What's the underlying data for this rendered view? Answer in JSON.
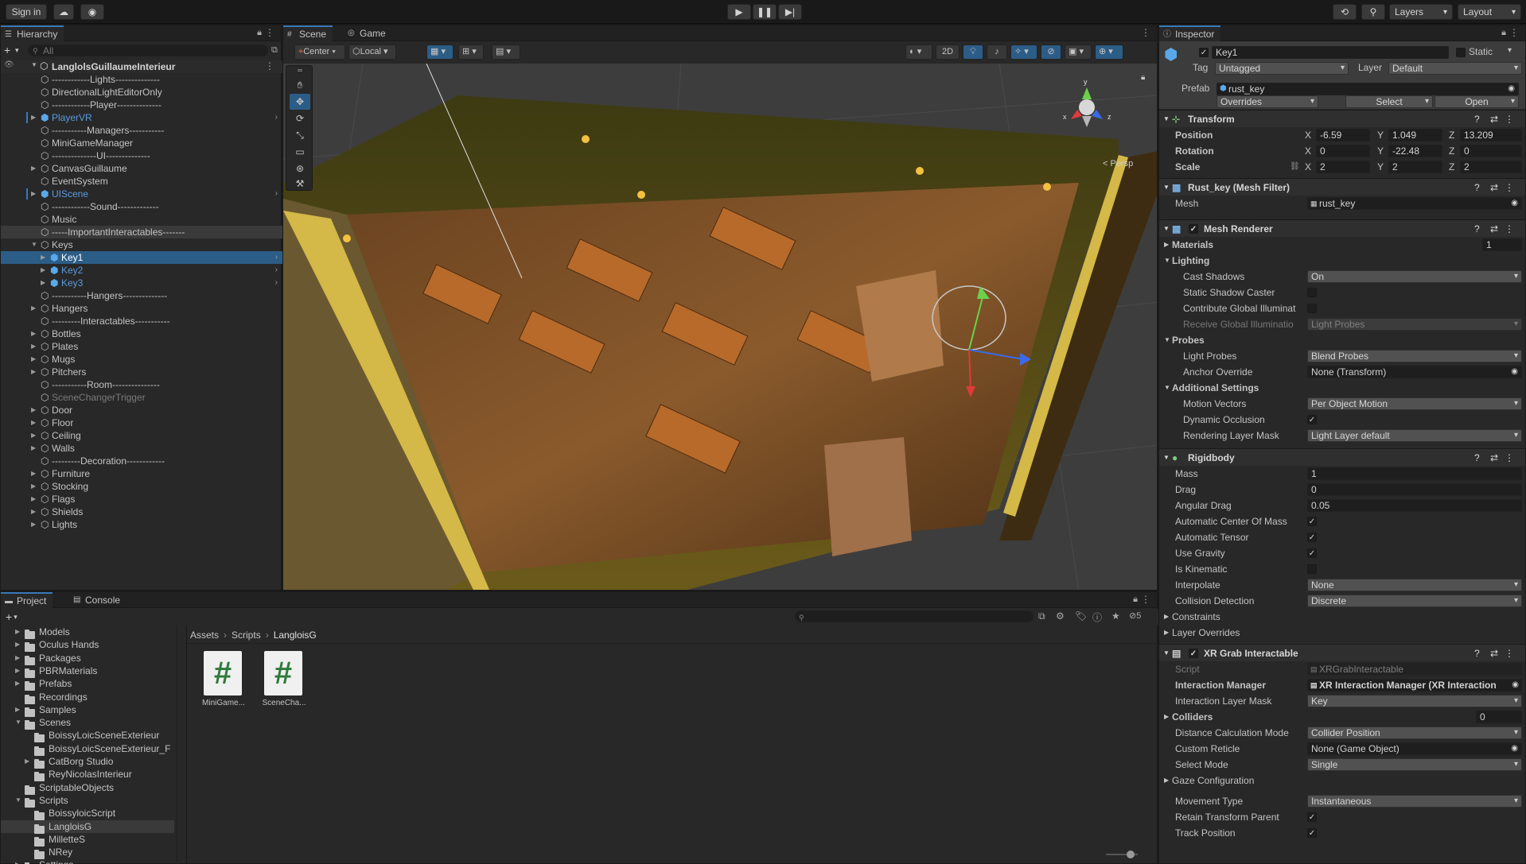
{
  "toolbar": {
    "sign_in": "Sign in",
    "layers": "Layers",
    "layout": "Layout"
  },
  "hierarchy": {
    "tab": "Hierarchy",
    "search_placeholder": "All",
    "scene": "LanglolsGuillaumeInterieur",
    "items": [
      {
        "label": "------------Lights--------------",
        "indent": 1,
        "arrow": false,
        "color": "#c4c4c4"
      },
      {
        "label": "DirectionalLightEditorOnly",
        "indent": 1,
        "arrow": false,
        "color": "#c4c4c4"
      },
      {
        "label": "------------Player--------------",
        "indent": 1,
        "arrow": false,
        "color": "#c4c4c4"
      },
      {
        "label": "PlayerVR",
        "indent": 1,
        "arrow": true,
        "color": "#5a9be0",
        "prefab": true
      },
      {
        "label": "-----------Managers-----------",
        "indent": 1,
        "arrow": false,
        "color": "#c4c4c4"
      },
      {
        "label": "MiniGameManager",
        "indent": 1,
        "arrow": false,
        "color": "#c4c4c4"
      },
      {
        "label": "--------------UI--------------",
        "indent": 1,
        "arrow": false,
        "color": "#c4c4c4"
      },
      {
        "label": "CanvasGuillaume",
        "indent": 1,
        "arrow": true,
        "color": "#c4c4c4"
      },
      {
        "label": "EventSystem",
        "indent": 1,
        "arrow": false,
        "color": "#c4c4c4"
      },
      {
        "label": "UIScene",
        "indent": 1,
        "arrow": true,
        "color": "#5a9be0",
        "prefab": true
      },
      {
        "label": "------------Sound-------------",
        "indent": 1,
        "arrow": false,
        "color": "#c4c4c4"
      },
      {
        "label": "Music",
        "indent": 1,
        "arrow": false,
        "color": "#c4c4c4"
      },
      {
        "label": "-----ImportantInteractables-------",
        "indent": 1,
        "arrow": false,
        "color": "#c4c4c4",
        "hover": true
      },
      {
        "label": "Keys",
        "indent": 1,
        "arrow": true,
        "open": true,
        "color": "#c4c4c4"
      },
      {
        "label": "Key1",
        "indent": 2,
        "arrow": true,
        "color": "#ffffff",
        "prefab": true,
        "selected": true
      },
      {
        "label": "Key2",
        "indent": 2,
        "arrow": true,
        "color": "#5a9be0",
        "prefab": true
      },
      {
        "label": "Key3",
        "indent": 2,
        "arrow": true,
        "color": "#5a9be0",
        "prefab": true
      },
      {
        "label": "-----------Hangers--------------",
        "indent": 1,
        "arrow": false,
        "color": "#c4c4c4"
      },
      {
        "label": "Hangers",
        "indent": 1,
        "arrow": true,
        "color": "#c4c4c4"
      },
      {
        "label": "---------Interactables-----------",
        "indent": 1,
        "arrow": false,
        "color": "#c4c4c4"
      },
      {
        "label": "Bottles",
        "indent": 1,
        "arrow": true,
        "color": "#c4c4c4"
      },
      {
        "label": "Plates",
        "indent": 1,
        "arrow": true,
        "color": "#c4c4c4"
      },
      {
        "label": "Mugs",
        "indent": 1,
        "arrow": true,
        "color": "#c4c4c4"
      },
      {
        "label": "Pitchers",
        "indent": 1,
        "arrow": true,
        "color": "#c4c4c4"
      },
      {
        "label": "-----------Room---------------",
        "indent": 1,
        "arrow": false,
        "color": "#c4c4c4"
      },
      {
        "label": "SceneChangerTrigger",
        "indent": 1,
        "arrow": false,
        "color": "#7a7a7a"
      },
      {
        "label": "Door",
        "indent": 1,
        "arrow": true,
        "color": "#c4c4c4"
      },
      {
        "label": "Floor",
        "indent": 1,
        "arrow": true,
        "color": "#c4c4c4"
      },
      {
        "label": "Ceiling",
        "indent": 1,
        "arrow": true,
        "color": "#c4c4c4"
      },
      {
        "label": "Walls",
        "indent": 1,
        "arrow": true,
        "color": "#c4c4c4"
      },
      {
        "label": "---------Decoration------------",
        "indent": 1,
        "arrow": false,
        "color": "#c4c4c4"
      },
      {
        "label": "Furniture",
        "indent": 1,
        "arrow": true,
        "color": "#c4c4c4"
      },
      {
        "label": "Stocking",
        "indent": 1,
        "arrow": true,
        "color": "#c4c4c4"
      },
      {
        "label": "Flags",
        "indent": 1,
        "arrow": true,
        "color": "#c4c4c4"
      },
      {
        "label": "Shields",
        "indent": 1,
        "arrow": true,
        "color": "#c4c4c4"
      },
      {
        "label": "Lights",
        "indent": 1,
        "arrow": true,
        "color": "#c4c4c4"
      }
    ]
  },
  "scene": {
    "tab_scene": "Scene",
    "tab_game": "Game",
    "pivot": "Center",
    "space": "Local",
    "mode2d": "2D",
    "persp": "< Persp",
    "gizmo_x": "x",
    "gizmo_y": "y",
    "gizmo_z": "z"
  },
  "project": {
    "tab_project": "Project",
    "tab_console": "Console",
    "hidden_count": "5",
    "breadcrumb": [
      "Assets",
      "Scripts",
      "LangloisG"
    ],
    "tree": [
      {
        "label": "Models",
        "indent": 1,
        "arrow": true
      },
      {
        "label": "Oculus Hands",
        "indent": 1,
        "arrow": true
      },
      {
        "label": "Packages",
        "indent": 1,
        "arrow": true
      },
      {
        "label": "PBRMaterials",
        "indent": 1,
        "arrow": true
      },
      {
        "label": "Prefabs",
        "indent": 1,
        "arrow": true
      },
      {
        "label": "Recordings",
        "indent": 1,
        "arrow": false
      },
      {
        "label": "Samples",
        "indent": 1,
        "arrow": true
      },
      {
        "label": "Scenes",
        "indent": 1,
        "arrow": true,
        "open": true
      },
      {
        "label": "BoissyLoicSceneExterieur",
        "indent": 2,
        "arrow": false
      },
      {
        "label": "BoissyLoicSceneExterieur_F",
        "indent": 2,
        "arrow": false
      },
      {
        "label": "CatBorg Studio",
        "indent": 2,
        "arrow": true
      },
      {
        "label": "ReyNicolasInterieur",
        "indent": 2,
        "arrow": false
      },
      {
        "label": "ScriptableObjects",
        "indent": 1,
        "arrow": false
      },
      {
        "label": "Scripts",
        "indent": 1,
        "arrow": true,
        "open": true
      },
      {
        "label": "BoissyloicScript",
        "indent": 2,
        "arrow": false
      },
      {
        "label": "LangloisG",
        "indent": 2,
        "arrow": false,
        "selected": true
      },
      {
        "label": "MilletteS",
        "indent": 2,
        "arrow": false
      },
      {
        "label": "NRey",
        "indent": 2,
        "arrow": false
      },
      {
        "label": "Settings",
        "indent": 1,
        "arrow": true
      }
    ],
    "assets": [
      {
        "label": "MiniGame..."
      },
      {
        "label": "SceneCha..."
      }
    ]
  },
  "inspector": {
    "tab": "Inspector",
    "name": "Key1",
    "static": "Static",
    "tag_label": "Tag",
    "tag": "Untagged",
    "layer_label": "Layer",
    "layer": "Default",
    "prefab_label": "Prefab",
    "prefab": "rust_key",
    "overrides": "Overrides",
    "select": "Select",
    "open": "Open",
    "transform": {
      "title": "Transform",
      "position": "Position",
      "rotation": "Rotation",
      "scale": "Scale",
      "x": "X",
      "y": "Y",
      "z": "Z",
      "pos": [
        "-6.59",
        "1.049",
        "13.209"
      ],
      "rot": [
        "0",
        "-22.48",
        "0"
      ],
      "scl": [
        "2",
        "2",
        "2"
      ]
    },
    "meshfilter": {
      "title": "Rust_key (Mesh Filter)",
      "mesh_label": "Mesh",
      "mesh": "rust_key"
    },
    "meshrenderer": {
      "title": "Mesh Renderer",
      "materials": "Materials",
      "materials_count": "1",
      "lighting": "Lighting",
      "cast_shadows": "Cast Shadows",
      "cast_shadows_val": "On",
      "static_shadow": "Static Shadow Caster",
      "contribute_gi": "Contribute Global Illuminat",
      "receive_gi": "Receive Global Illuminatio",
      "receive_gi_val": "Light Probes",
      "probes": "Probes",
      "light_probes": "Light Probes",
      "light_probes_val": "Blend Probes",
      "anchor": "Anchor Override",
      "anchor_val": "None (Transform)",
      "additional": "Additional Settings",
      "motion": "Motion Vectors",
      "motion_val": "Per Object Motion",
      "dyn_occ": "Dynamic Occlusion",
      "rlm": "Rendering Layer Mask",
      "rlm_val": "Light Layer default"
    },
    "rigidbody": {
      "title": "Rigidbody",
      "mass": "Mass",
      "mass_val": "1",
      "drag": "Drag",
      "drag_val": "0",
      "adrag": "Angular Drag",
      "adrag_val": "0.05",
      "acom": "Automatic Center Of Mass",
      "atensor": "Automatic Tensor",
      "gravity": "Use Gravity",
      "kinematic": "Is Kinematic",
      "interp": "Interpolate",
      "interp_val": "None",
      "coll": "Collision Detection",
      "coll_val": "Discrete",
      "constraints": "Constraints",
      "layer_ov": "Layer Overrides"
    },
    "xr": {
      "title": "XR Grab Interactable",
      "script": "Script",
      "script_val": "XRGrabInteractable",
      "im": "Interaction Manager",
      "im_val": "XR Interaction Manager (XR Interaction",
      "ilm": "Interaction Layer Mask",
      "ilm_val": "Key",
      "colliders": "Colliders",
      "colliders_val": "0",
      "dcm": "Distance Calculation Mode",
      "dcm_val": "Collider Position",
      "reticle": "Custom Reticle",
      "reticle_val": "None (Game Object)",
      "selmode": "Select Mode",
      "selmode_val": "Single",
      "gaze": "Gaze Configuration",
      "movement": "Movement Type",
      "movement_val": "Instantaneous",
      "retain": "Retain Transform Parent",
      "track": "Track Position"
    }
  }
}
